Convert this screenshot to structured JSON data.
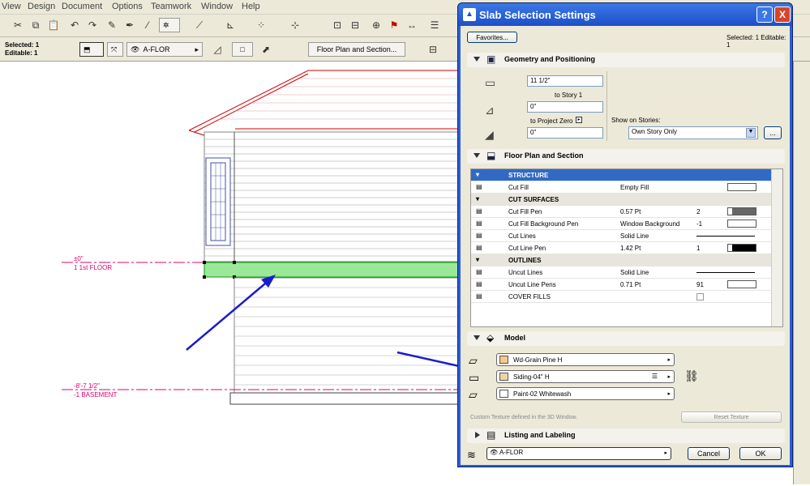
{
  "menubar": {
    "items": [
      "View",
      "Design",
      "Document",
      "Options",
      "Teamwork",
      "Window",
      "Help"
    ]
  },
  "infobox": {
    "selected": "Selected: 1",
    "editable": "Editable: 1",
    "layer": "A-FLOR",
    "floor_plan_btn": "Floor Plan and Section..."
  },
  "drawing": {
    "level1_value": "±0\"",
    "level1_name": "1 1st FLOOR",
    "level2_value": "-8'-7 1/2\"",
    "level2_name": "-1 BASEMENT"
  },
  "dialog": {
    "title": "Slab Selection Settings",
    "help": "?",
    "close": "X",
    "favorites": "Favorites...",
    "status": "Selected: 1 Editable: 1",
    "geometry": {
      "label": "Geometry and Positioning",
      "thickness": "11 1/2\"",
      "to_story": "to Story 1",
      "offset": "0\"",
      "to_project_zero": "to Project Zero",
      "elevation": "0\"",
      "show_on_stories_label": "Show on Stories:",
      "show_on_stories_value": "Own Story Only",
      "more": "..."
    },
    "floorplan": {
      "label": "Floor Plan and Section",
      "rows": [
        {
          "name": "STRUCTURE",
          "value": "",
          "num": "",
          "type": "header-sel"
        },
        {
          "name": "Cut Fill",
          "value": "Empty Fill",
          "num": "",
          "type": "swatch"
        },
        {
          "name": "CUT SURFACES",
          "value": "",
          "num": "",
          "type": "group"
        },
        {
          "name": "Cut Fill Pen",
          "value": "0.57 Pt",
          "num": "2",
          "type": "pen"
        },
        {
          "name": "Cut Fill Background Pen",
          "value": "Window Background",
          "num": "-1",
          "type": "swatch"
        },
        {
          "name": "Cut Lines",
          "value": "Solid Line",
          "num": "",
          "type": "line"
        },
        {
          "name": "Cut Line Pen",
          "value": "1.42 Pt",
          "num": "1",
          "type": "black"
        },
        {
          "name": "OUTLINES",
          "value": "",
          "num": "",
          "type": "group"
        },
        {
          "name": "Uncut Lines",
          "value": "Solid Line",
          "num": "",
          "type": "line"
        },
        {
          "name": "Uncut Line Pens",
          "value": "0.71 Pt",
          "num": "91",
          "type": "swatch"
        },
        {
          "name": "COVER FILLS",
          "value": "",
          "num": "",
          "type": "check"
        }
      ]
    },
    "model": {
      "label": "Model",
      "materials": [
        {
          "name": "Wd-Grain Pine H",
          "color": "#f5c98a"
        },
        {
          "name": "Siding-04\" H",
          "color": "#f3d2a4"
        },
        {
          "name": "Paint-02 Whitewash",
          "color": "#ffffff"
        }
      ],
      "custom_texture": "Custom Texture defined in the 3D Window.",
      "reset_texture": "Reset Texture"
    },
    "listing": {
      "label": "Listing and Labeling"
    },
    "layer": "A-FLOR",
    "cancel": "Cancel",
    "ok": "OK"
  },
  "colors": {
    "accent": "#316ac5",
    "level": "#e0006e",
    "highlight": "#00d000",
    "arrow": "#1a1ad0"
  }
}
